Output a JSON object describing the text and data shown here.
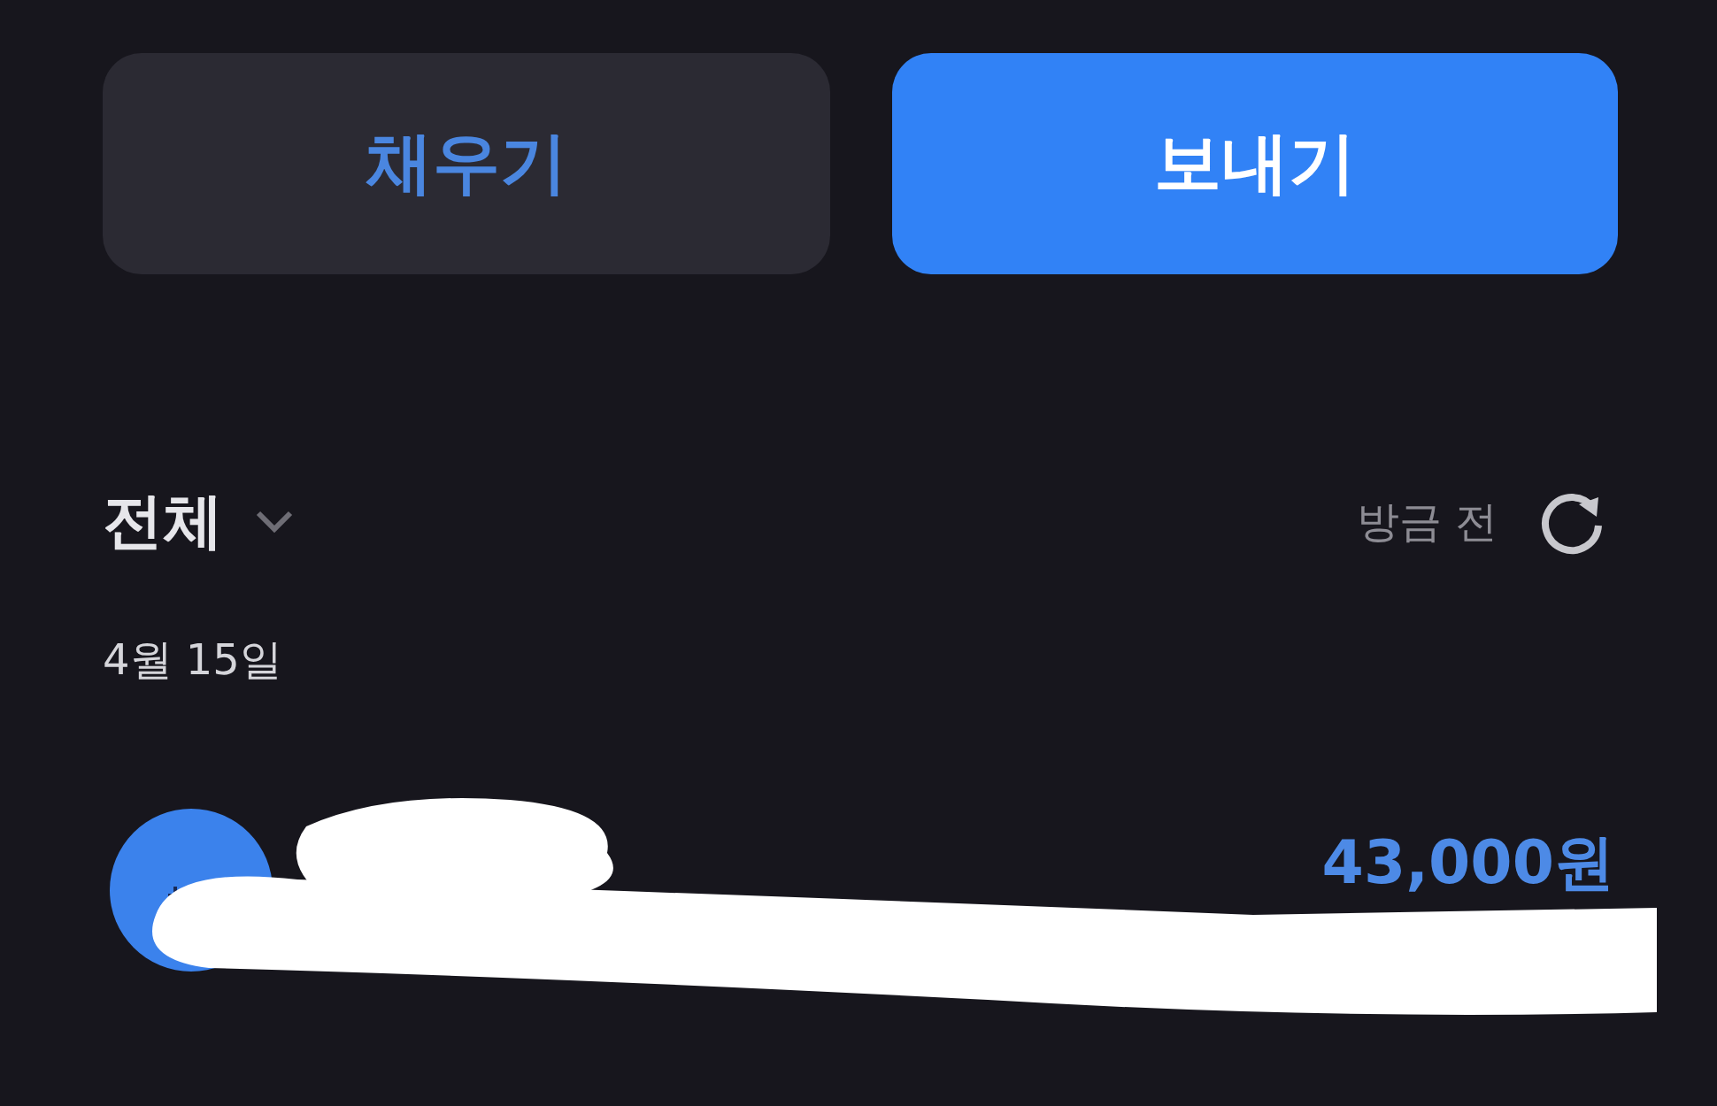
{
  "buttons": [
    {
      "label": "채우기",
      "kind": "secondary"
    },
    {
      "label": "보내기",
      "kind": "primary"
    }
  ],
  "filter": {
    "label": "전체",
    "updated": "방금 전"
  },
  "date": "4월 15일",
  "transactions": [
    {
      "amount": "43,000원",
      "redacted": true
    }
  ]
}
